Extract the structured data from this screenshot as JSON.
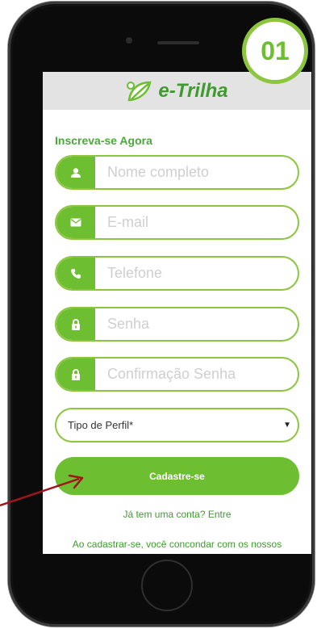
{
  "step_badge": "01",
  "brand": {
    "name": "e-Trilha"
  },
  "form": {
    "title": "Inscreva-se Agora",
    "fields": [
      {
        "icon": "user-icon",
        "placeholder": "Nome completo"
      },
      {
        "icon": "envelope-icon",
        "placeholder": "E-mail"
      },
      {
        "icon": "phone-icon",
        "placeholder": "Telefone"
      },
      {
        "icon": "lock-icon",
        "placeholder": "Senha"
      },
      {
        "icon": "lock-icon",
        "placeholder": "Confirmação Senha"
      }
    ],
    "profile_select": {
      "selected": "Tipo de Perfil*"
    },
    "submit_label": "Cadastre-se",
    "login_link": "Já tem uma conta? Entre",
    "terms_text": "Ao cadastrar-se, você concondar com os nossos"
  },
  "colors": {
    "accent": "#6dbe30",
    "border": "#8cc63f",
    "text_green": "#3f9a2f",
    "annotation_arrow": "#a0141a"
  }
}
